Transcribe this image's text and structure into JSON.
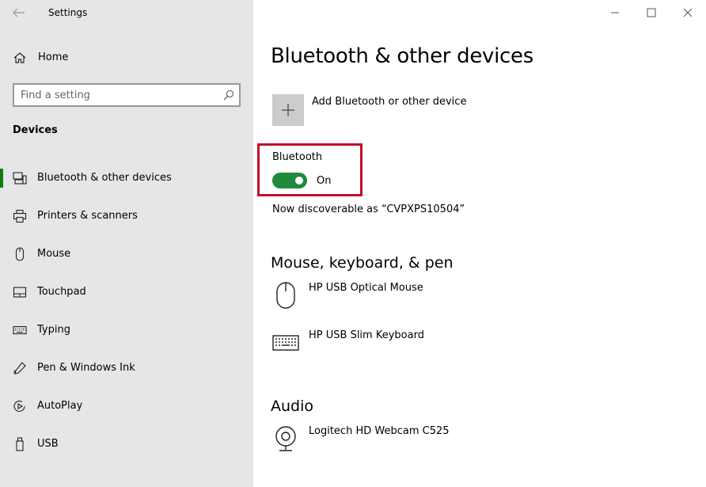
{
  "window": {
    "app_title": "Settings",
    "back_icon": "arrow-left-icon",
    "controls": [
      "minimize-icon",
      "maximize-icon",
      "close-icon"
    ]
  },
  "sidebar": {
    "home_label": "Home",
    "search_placeholder": "Find a setting",
    "section_heading": "Devices",
    "items": [
      {
        "label": "Bluetooth & other devices",
        "icon": "bluetooth-devices-icon",
        "selected": true
      },
      {
        "label": "Printers & scanners",
        "icon": "printer-icon",
        "selected": false
      },
      {
        "label": "Mouse",
        "icon": "mouse-icon",
        "selected": false
      },
      {
        "label": "Touchpad",
        "icon": "touchpad-icon",
        "selected": false
      },
      {
        "label": "Typing",
        "icon": "keyboard-icon",
        "selected": false
      },
      {
        "label": "Pen & Windows Ink",
        "icon": "pen-icon",
        "selected": false
      },
      {
        "label": "AutoPlay",
        "icon": "autoplay-icon",
        "selected": false
      },
      {
        "label": "USB",
        "icon": "usb-icon",
        "selected": false
      }
    ]
  },
  "main": {
    "title": "Bluetooth & other devices",
    "add_device_label": "Add Bluetooth or other device",
    "bluetooth": {
      "label": "Bluetooth",
      "state": "On",
      "discoverable_text": "Now discoverable as “CVPXPS10504”"
    },
    "groups": [
      {
        "heading": "Mouse, keyboard, & pen",
        "devices": [
          {
            "name": "HP USB Optical Mouse",
            "icon": "mouse-icon"
          },
          {
            "name": "HP USB Slim Keyboard",
            "icon": "keyboard-icon"
          }
        ]
      },
      {
        "heading": "Audio",
        "devices": [
          {
            "name": "Logitech HD Webcam C525",
            "icon": "webcam-icon"
          }
        ]
      }
    ]
  },
  "colors": {
    "sidebar_bg": "#e6e6e6",
    "accent_green": "#1e8a3c",
    "highlight_red": "#c0102a",
    "tile_gray": "#cccccc"
  }
}
